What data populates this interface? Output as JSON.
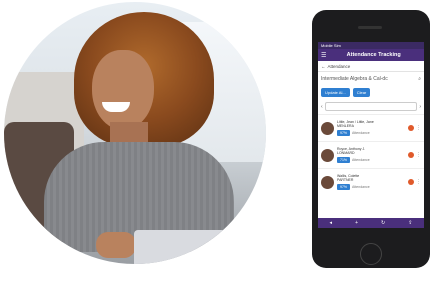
{
  "phone": {
    "status_left": "Mobile Sim",
    "status_center": "",
    "status_right": "",
    "app_title": "Attendance Tracking",
    "breadcrumb": "Attendance",
    "course_title": "Intermediate Algebra & Cal-dc",
    "pills": [
      "Update Al...",
      "Clear"
    ],
    "rows": [
      {
        "name": "Little, Jean / Little, Jane",
        "sub": "MENLERA",
        "percent": "97%",
        "status": "Attendance"
      },
      {
        "name": "Royce, Anthony J.",
        "sub": "LONMARD",
        "percent": "71%",
        "status": "Attendance"
      },
      {
        "name": "Wallis, Colette",
        "sub": "PARTNER",
        "percent": "97%",
        "status": "Attendance"
      }
    ],
    "bottom_icons": [
      "back-icon",
      "add-icon",
      "refresh-icon",
      "share-icon"
    ]
  },
  "colors": {
    "appbar": "#4a2f7c",
    "pill": "#2f7fd1",
    "status_dot": "#e05a2b"
  }
}
